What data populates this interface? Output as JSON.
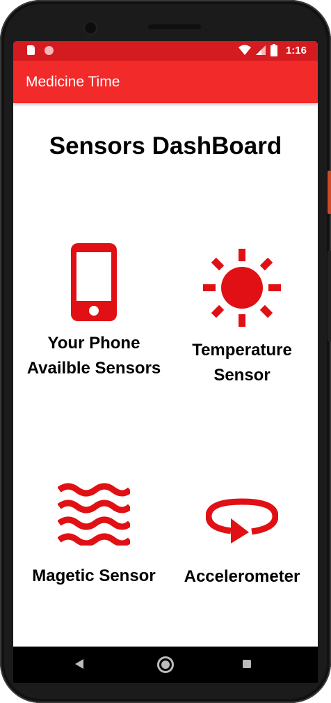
{
  "status_bar": {
    "time": "1:16",
    "icons": [
      "sd-card-icon",
      "notification-dot-icon",
      "wifi-icon",
      "signal-icon",
      "battery-icon"
    ]
  },
  "app_bar": {
    "title": "Medicine Time"
  },
  "page": {
    "title": "Sensors DashBoard"
  },
  "tiles": [
    {
      "icon": "phone-icon",
      "label_line1": "Your Phone",
      "label_line2": "Availble Sensors"
    },
    {
      "icon": "sun-icon",
      "label_line1": "Temperature",
      "label_line2": "Sensor"
    },
    {
      "icon": "waves-icon",
      "label_line1": "Magetic Sensor",
      "label_line2": ""
    },
    {
      "icon": "rotate-arrow-icon",
      "label_line1": "Accelerometer",
      "label_line2": ""
    }
  ],
  "nav_bar": {
    "icons": [
      "back-icon",
      "home-icon",
      "recents-icon"
    ]
  },
  "colors": {
    "status_bar": "#d41b1f",
    "app_bar": "#f22a2a",
    "icon_red": "#e01014",
    "text": "#000000"
  }
}
